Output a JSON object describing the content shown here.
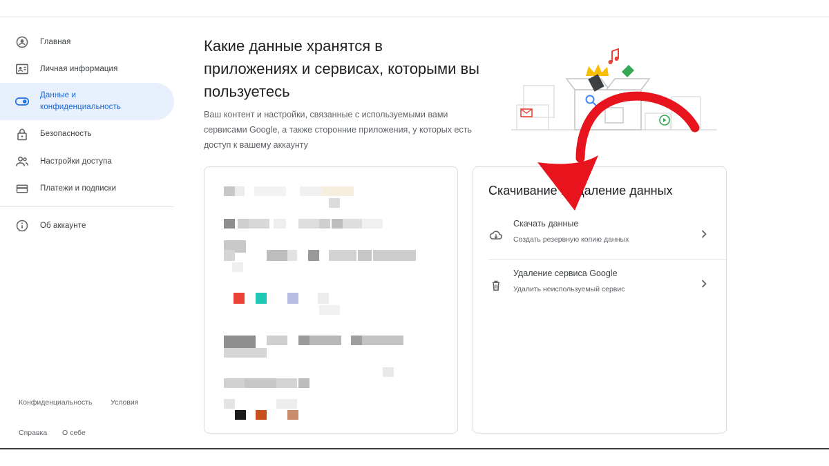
{
  "sidebar": {
    "items": [
      {
        "label": "Главная",
        "icon": "account-circle-icon"
      },
      {
        "label": "Личная информация",
        "icon": "id-card-icon"
      },
      {
        "label": "Данные и конфиденциальность",
        "icon": "toggle-icon",
        "active": true
      },
      {
        "label": "Безопасность",
        "icon": "lock-icon"
      },
      {
        "label": "Настройки доступа",
        "icon": "people-icon"
      },
      {
        "label": "Платежи и подписки",
        "icon": "credit-card-icon"
      },
      {
        "label": "Об аккаунте",
        "icon": "info-icon"
      }
    ],
    "footer": {
      "privacy": "Конфиденциальность",
      "terms": "Условия",
      "help": "Справка",
      "about": "О себе"
    }
  },
  "main": {
    "title": "Какие данные хранятся в приложениях и сервисах, которыми вы пользуетесь",
    "description": "Ваш контент и настройки, связанные с используемыми вами сервисами Google, а также сторонние приложения, у которых есть доступ к вашему аккаунту"
  },
  "download_card": {
    "title": "Скачивание и удаление данных",
    "rows": [
      {
        "title": "Скачать данные",
        "subtitle": "Создать резервную копию данных",
        "icon": "cloud-download-icon"
      },
      {
        "title": "Удаление сервиса Google",
        "subtitle": "Удалить неиспользуемый сервис",
        "icon": "trash-icon"
      }
    ]
  },
  "colors": {
    "accent": "#1a73e8",
    "active_bg": "#e8f0fe",
    "arrow": "#e8141d"
  }
}
